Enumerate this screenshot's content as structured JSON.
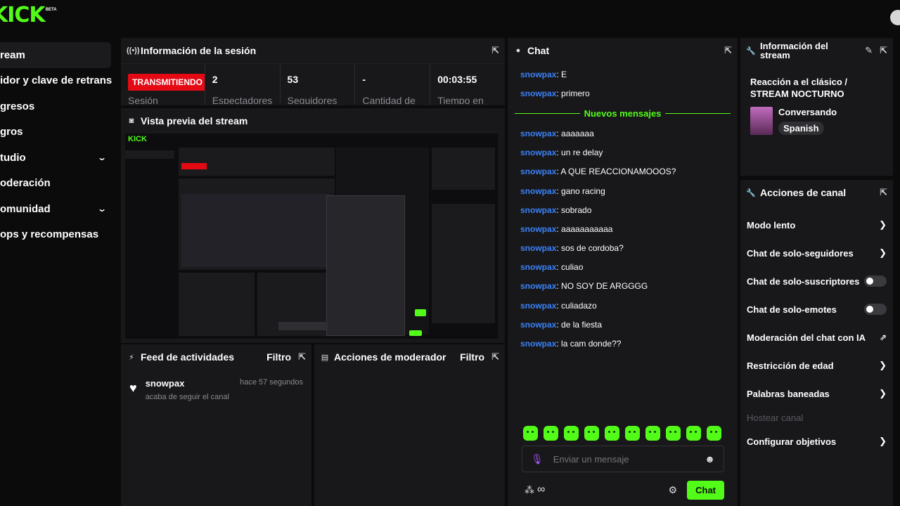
{
  "logo": {
    "text": "KICK",
    "badge": "BETA"
  },
  "nav": [
    {
      "label": "ream",
      "active": true,
      "chevron": false
    },
    {
      "label": "idor y clave de retransm",
      "active": false,
      "chevron": false
    },
    {
      "label": "gresos",
      "active": false,
      "chevron": false
    },
    {
      "label": "gros",
      "active": false,
      "chevron": false
    },
    {
      "label": "tudio",
      "active": false,
      "chevron": true
    },
    {
      "label": "oderación",
      "active": false,
      "chevron": false
    },
    {
      "label": "omunidad",
      "active": false,
      "chevron": true
    },
    {
      "label": "ops y recompensas",
      "active": false,
      "chevron": false
    }
  ],
  "session": {
    "title": "Información de la sesión",
    "status_badge": "TRANSMITIENDO",
    "status_label": "Sesión",
    "stats": [
      {
        "value": "2",
        "label": "Espectadores"
      },
      {
        "value": "53",
        "label": "Seguidores"
      },
      {
        "value": "-",
        "label": "Cantidad de"
      },
      {
        "value": "00:03:55",
        "label": "Tiempo en"
      }
    ]
  },
  "preview": {
    "title": "Vista previa del stream"
  },
  "feed": {
    "title": "Feed de actividades",
    "filter": "Filtro",
    "items": [
      {
        "user": "snowpax",
        "time": "hace 57 segundos",
        "desc": "acaba de seguir el canal"
      }
    ]
  },
  "mod": {
    "title": "Acciones de moderador",
    "filter": "Filtro"
  },
  "chat": {
    "title": "Chat",
    "messages_before": [
      {
        "user": "snowpax",
        "text": ": E"
      },
      {
        "user": "snowpax",
        "text": ": primero"
      }
    ],
    "divider": "Nuevos mensajes",
    "messages_after": [
      {
        "user": "snowpax",
        "text": ": aaaaaaa"
      },
      {
        "user": "snowpax",
        "text": ": un re delay"
      },
      {
        "user": "snowpax",
        "text": ": A QUE REACCIONAMOOOS?"
      },
      {
        "user": "snowpax",
        "text": ": gano racing"
      },
      {
        "user": "snowpax",
        "text": ": sobrado"
      },
      {
        "user": "snowpax",
        "text": ": aaaaaaaaaaa"
      },
      {
        "user": "snowpax",
        "text": ": sos de cordoba?"
      },
      {
        "user": "snowpax",
        "text": ": culiao"
      },
      {
        "user": "snowpax",
        "text": ": NO SOY DE ARGGGG"
      },
      {
        "user": "snowpax",
        "text": ": culiadazo"
      },
      {
        "user": "snowpax",
        "text": ": de la fiesta"
      },
      {
        "user": "snowpax",
        "text": ": la cam donde??"
      }
    ],
    "input_placeholder": "Enviar un mensaje",
    "send_label": "Chat"
  },
  "stream_info": {
    "title": "Información del stream",
    "stream_title": "Reacción a el clásico / STREAM NOCTURNO",
    "category": "Conversando",
    "language": "Spanish"
  },
  "channel_actions": {
    "title": "Acciones de canal",
    "items": [
      {
        "label": "Modo lento",
        "type": "chevron"
      },
      {
        "label": "Chat de solo-seguidores",
        "type": "chevron"
      },
      {
        "label": "Chat de solo-suscriptores",
        "type": "toggle"
      },
      {
        "label": "Chat de solo-emotes",
        "type": "toggle"
      },
      {
        "label": "Moderación del chat con IA",
        "type": "external"
      },
      {
        "label": "Restricción de edad",
        "type": "chevron"
      },
      {
        "label": "Palabras baneadas",
        "type": "chevron"
      },
      {
        "label": "Hostear canal",
        "type": "disabled"
      },
      {
        "label": "Configurar objetivos",
        "type": "chevron"
      }
    ]
  },
  "colors": {
    "accent": "#53fc18",
    "live": "#e50914",
    "username": "#3b82f6",
    "panel": "#18181b"
  }
}
